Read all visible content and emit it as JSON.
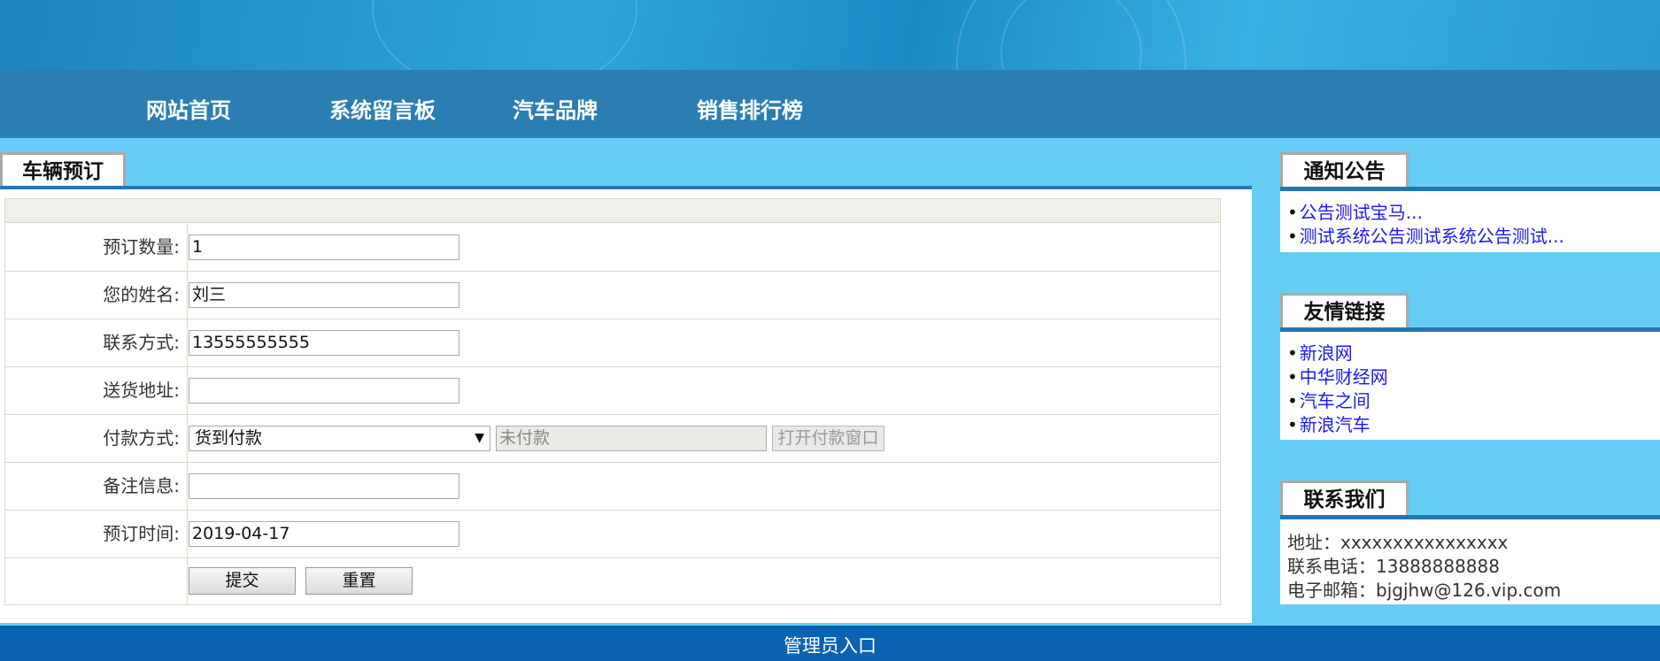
{
  "nav": {
    "items": [
      "网站首页",
      "系统留言板",
      "汽车品牌",
      "销售排行榜"
    ]
  },
  "main": {
    "title": "车辆预订"
  },
  "form": {
    "labels": [
      "预订数量:",
      "您的姓名:",
      "联系方式:",
      "送货地址:",
      "付款方式:",
      "备注信息:",
      "预订时间:"
    ],
    "quantity": "1",
    "name": "刘三",
    "phone": "13555555555",
    "address": "",
    "payment_method": "货到付款",
    "payment_status": "未付款",
    "open_payment_button": "打开付款窗口",
    "remarks": "",
    "order_date": "2019-04-17",
    "submit_button": "提交",
    "reset_button": "重置"
  },
  "sidebar": {
    "notice": {
      "title": "通知公告",
      "items": [
        "公告测试宝马...",
        "测试系统公告测试系统公告测试..."
      ]
    },
    "links": {
      "title": "友情链接",
      "items": [
        "新浪网",
        "中华财经网",
        "汽车之间",
        "新浪汽车"
      ]
    },
    "contact": {
      "title": "联系我们",
      "address": "地址：xxxxxxxxxxxxxxxx",
      "phone": "联系电话：13888888888",
      "email": "电子邮箱：bjgjhw@126.vip.com"
    }
  },
  "footer": {
    "admin_link": "管理员入口"
  },
  "colors": {
    "nav_bg": "#2a7eb2",
    "page_bg": "#66cdf4",
    "accent_line": "#2575b5",
    "footer_bg": "#0a62b2",
    "link": "#1a1aef"
  }
}
